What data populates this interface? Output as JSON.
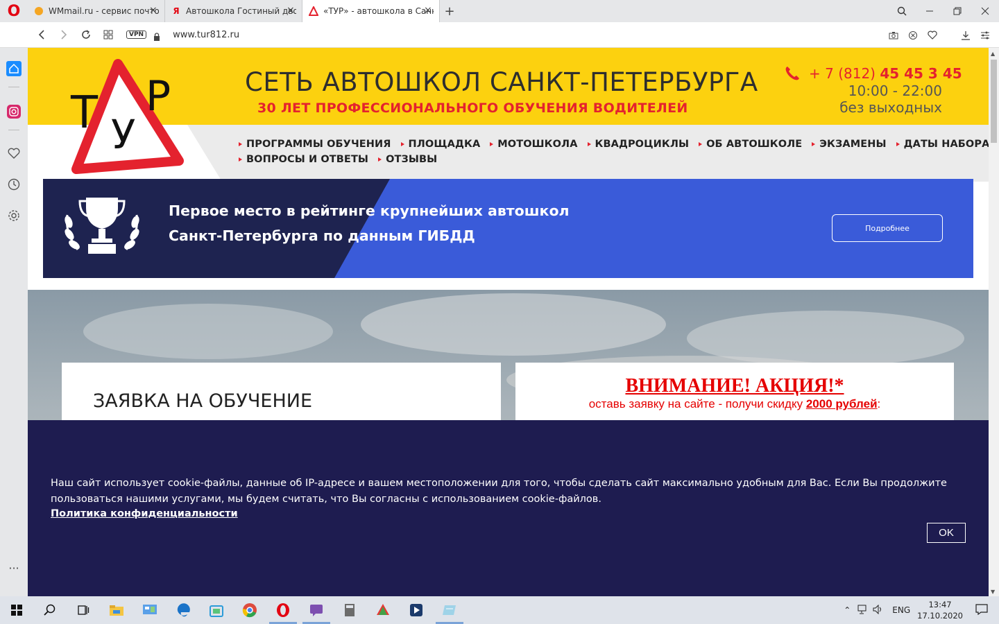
{
  "browser": {
    "tabs": [
      {
        "title": "WMmail.ru - сервис почто",
        "active": false
      },
      {
        "title": "Автошкола Гостиный двор",
        "active": false
      },
      {
        "title": "«ТУР» - автошкола в Санк",
        "active": true
      }
    ],
    "url": "www.tur812.ru",
    "vpn_label": "VPN"
  },
  "header": {
    "logo_text": "ТУР",
    "title": "СЕТЬ АВТОШКОЛ САНКТ-ПЕТЕРБУРГА",
    "subtitle": "30 ЛЕТ ПРОФЕССИОНАЛЬНОГО ОБУЧЕНИЯ ВОДИТЕЛЕЙ",
    "phone_prefix": "+ 7 (812) ",
    "phone_number": "45 45 3 45",
    "hours": "10:00 - 22:00",
    "days": "без выходных"
  },
  "nav": {
    "row1": [
      "ПРОГРАММЫ ОБУЧЕНИЯ",
      "ПЛОЩАДКА",
      "МОТОШКОЛА",
      "КВАДРОЦИКЛЫ",
      "ОБ АВТОШКОЛЕ",
      "ЭКЗАМЕНЫ",
      "ДАТЫ НАБОРА"
    ],
    "row2": [
      "ВОПРОСЫ И ОТВЕТЫ",
      "ОТЗЫВЫ"
    ]
  },
  "banner": {
    "line1": "Первое место в рейтинге крупнейших автошкол",
    "line2": "Санкт-Петербурга по данным ГИБДД",
    "button": "Подробнее"
  },
  "form_card": {
    "title": "ЗАЯВКА НА ОБУЧЕНИЕ"
  },
  "promo_card": {
    "title": "ВНИМАНИЕ! АКЦИЯ!*",
    "sub_before": "оставь заявку на сайте - получи скидку ",
    "sub_amount": "2000 рублей",
    "sub_after": ":"
  },
  "cookie": {
    "text": "Наш сайт использует cookie-файлы, данные об IP-адресе и вашем местоположении для того, чтобы сделать сайт максимально удобным для Вас. Если Вы продолжите пользоваться нашими услугами, мы будем считать, что Вы согласны с использованием cookie-файлов.",
    "policy_link": "Политика конфиденциальности",
    "ok": "OK"
  },
  "taskbar": {
    "lang": "ENG",
    "time": "13:47",
    "date": "17.10.2020"
  },
  "colors": {
    "yellow": "#fcd10f",
    "red": "#e4222e",
    "navy": "#1e1c50",
    "banner_blue": "#3a5bd9"
  }
}
